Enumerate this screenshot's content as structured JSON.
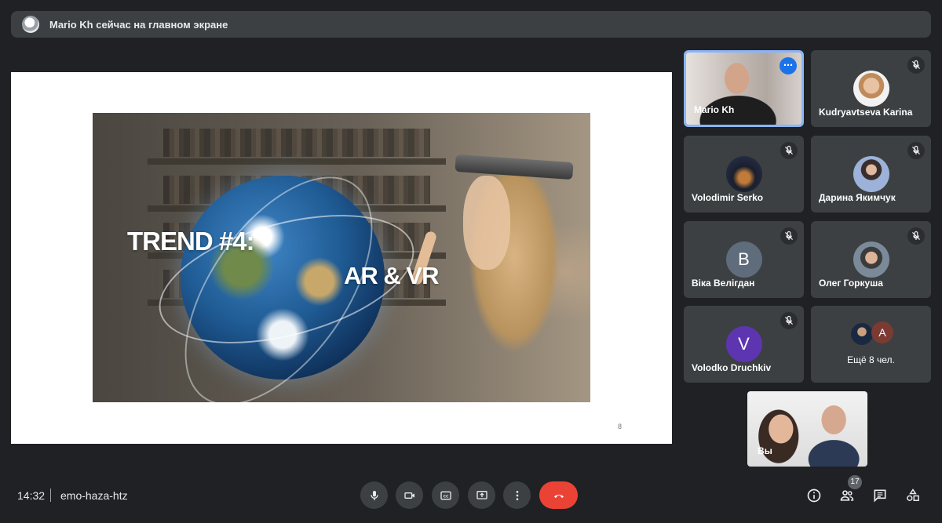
{
  "banner": {
    "text": "Mario Kh сейчас на главном экране"
  },
  "slide": {
    "title_line1": "TREND #4:",
    "title_line2": "AR & VR",
    "page_number": "8"
  },
  "participants": [
    {
      "name": "Mario Kh",
      "avatar_letter": "",
      "muted": false,
      "active": true
    },
    {
      "name": "Kudryavtseva Karina",
      "avatar_letter": "",
      "muted": true
    },
    {
      "name": "Volodimir Serko",
      "avatar_letter": "",
      "muted": true
    },
    {
      "name": "Дарина Якимчук",
      "avatar_letter": "",
      "muted": true
    },
    {
      "name": "Віка Велігдан",
      "avatar_letter": "B",
      "avatar_color": "#5f6c7b",
      "muted": true
    },
    {
      "name": "Олег Горкуша",
      "avatar_letter": "",
      "muted": true
    },
    {
      "name": "Volodko Druchkiv",
      "avatar_letter": "V",
      "avatar_color": "#5e35b1",
      "muted": true
    }
  ],
  "more": {
    "text": "Ещё 8 чел.",
    "avatar_letter": "A"
  },
  "self_view": {
    "label": "Вы"
  },
  "footer": {
    "time": "14:32",
    "meeting_code": "emo-haza-htz",
    "people_count": "17"
  },
  "controls": [
    "mic-icon",
    "camera-icon",
    "captions-icon",
    "present-icon",
    "more-vert-icon",
    "end-call-icon"
  ],
  "right_controls": [
    "info-icon",
    "people-icon",
    "chat-icon",
    "activities-icon"
  ],
  "colors": {
    "background": "#202124",
    "tile": "#3c4043",
    "accent": "#8ab4f8",
    "end_call": "#ea4335"
  }
}
